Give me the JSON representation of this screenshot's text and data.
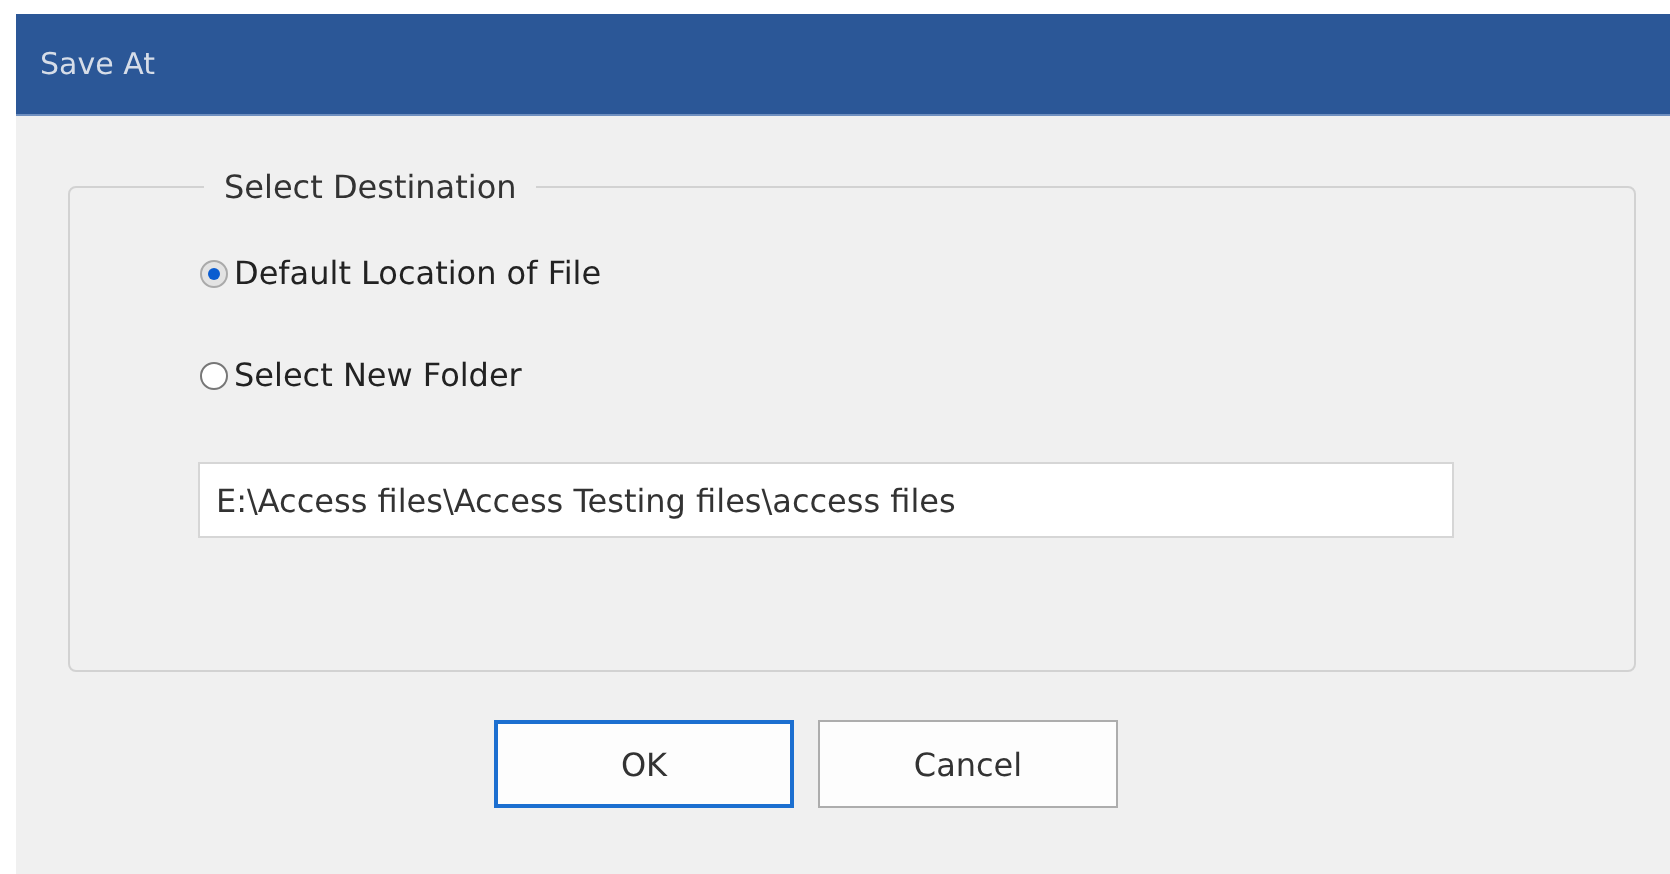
{
  "window": {
    "title": "Save At"
  },
  "group": {
    "legend": "Select Destination"
  },
  "options": [
    {
      "label": "Default Location of File",
      "selected": true
    },
    {
      "label": "Select New Folder",
      "selected": false
    }
  ],
  "path_field": {
    "value": "E:\\Access files\\Access Testing files\\access files"
  },
  "buttons": [
    {
      "label": "OK",
      "focused": true
    },
    {
      "label": "Cancel",
      "focused": false
    }
  ]
}
